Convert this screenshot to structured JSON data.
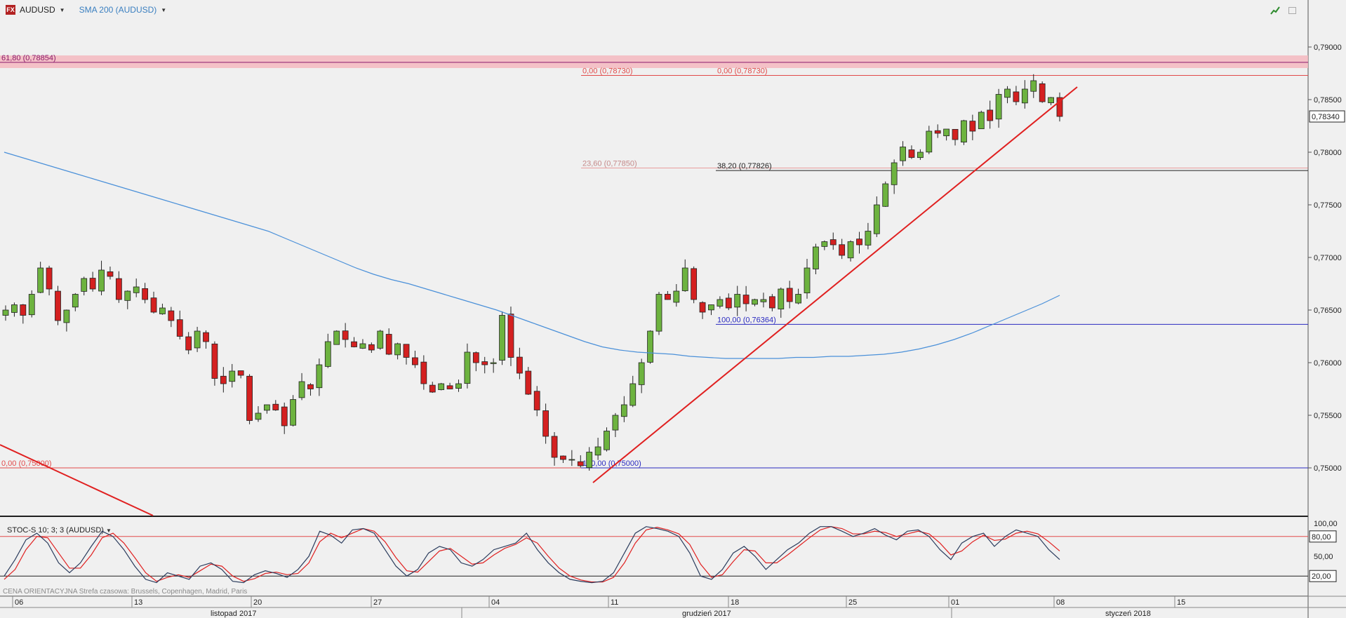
{
  "header": {
    "symbol": "AUDUSD",
    "indicator": "SMA 200 (AUDUSD)"
  },
  "stoch_header": "STOC-S 10; 3; 3 (AUDUSD)",
  "footer_note": "CENA ORIENTACYJNA   Strefa czasowa: Brussels, Copenhagen, Madrid, Paris",
  "colors": {
    "bull": "#6db33f",
    "bear": "#d42020",
    "sma": "#4a90d9",
    "trend": "#e02020",
    "fib_red": "#e24a4a",
    "fib_blue": "#2a2ac0",
    "zone": "#f4b8c0"
  },
  "chart_data": {
    "type": "candlestick",
    "price_axis": {
      "ticks": [
        "0,79000",
        "0,78500",
        "0,78000",
        "0,77500",
        "0,77000",
        "0,76500",
        "0,76000",
        "0,75500",
        "0,75000"
      ],
      "tick_values": [
        0.79,
        0.785,
        0.78,
        0.775,
        0.77,
        0.765,
        0.76,
        0.755,
        0.75
      ],
      "current_price": "0,78340",
      "current_value": 0.7834
    },
    "fib_levels": [
      {
        "label": "61,80 (0,78854)",
        "value": 0.78854,
        "color": "purple"
      },
      {
        "label": "0,00 (0,78730)",
        "value": 0.7873,
        "color": "red"
      },
      {
        "label": "0,00 (0,78730)",
        "value": 0.7873,
        "color": "red"
      },
      {
        "label": "23,60 (0,77850)",
        "value": 0.7785,
        "color": "red"
      },
      {
        "label": "38,20 (0,77826)",
        "value": 0.77826,
        "color": "black"
      },
      {
        "label": "100,00 (0,76364)",
        "value": 0.76364,
        "color": "blue"
      },
      {
        "label": "0,00 (0,75000)",
        "value": 0.75,
        "color": "red"
      },
      {
        "label": "100,00 (0,75000)",
        "value": 0.75,
        "color": "blue"
      }
    ],
    "resistance_zone": [
      0.788,
      0.7892
    ],
    "date_axis": {
      "days": [
        "06",
        "13",
        "20",
        "27",
        "04",
        "11",
        "18",
        "25",
        "01",
        "08",
        "15"
      ],
      "months": [
        "listopad 2017",
        "grudzień 2017",
        "styczeń 2018"
      ]
    },
    "ohlc_path": [
      0.765,
      0.7655,
      0.7645,
      0.7665,
      0.769,
      0.767,
      0.764,
      0.765,
      0.7665,
      0.768,
      0.767,
      0.7688,
      0.7682,
      0.766,
      0.7668,
      0.7672,
      0.766,
      0.7648,
      0.7652,
      0.764,
      0.7625,
      0.7612,
      0.763,
      0.762,
      0.7585,
      0.758,
      0.7592,
      0.7588,
      0.7545,
      0.7552,
      0.756,
      0.7555,
      0.754,
      0.7565,
      0.7582,
      0.7575,
      0.7598,
      0.762,
      0.763,
      0.7622,
      0.7615,
      0.7618,
      0.7612,
      0.763,
      0.7608,
      0.7618,
      0.7605,
      0.7598,
      0.758,
      0.7572,
      0.758,
      0.7575,
      0.758,
      0.761,
      0.76,
      0.7598,
      0.76,
      0.7645,
      0.7605,
      0.759,
      0.757,
      0.7555,
      0.753,
      0.751,
      0.7508,
      0.7508,
      0.7502,
      0.7515,
      0.752,
      0.7535,
      0.755,
      0.756,
      0.758,
      0.76,
      0.763,
      0.7665,
      0.766,
      0.7668,
      0.769,
      0.766,
      0.7648,
      0.7655,
      0.766,
      0.7652,
      0.7665,
      0.7656,
      0.766,
      0.766,
      0.7652,
      0.767,
      0.7658,
      0.7665,
      0.769,
      0.771,
      0.7715,
      0.7712,
      0.7702,
      0.7715,
      0.7712,
      0.7725,
      0.775,
      0.777,
      0.779,
      0.7805,
      0.7795,
      0.78,
      0.782,
      0.7818,
      0.7822,
      0.7812,
      0.783,
      0.782,
      0.7838,
      0.783,
      0.7855,
      0.786,
      0.7848,
      0.786,
      0.7868,
      0.7848,
      0.7852,
      0.7834
    ],
    "sma_200": [
      0.78,
      0.7795,
      0.779,
      0.7785,
      0.778,
      0.7775,
      0.777,
      0.7765,
      0.776,
      0.7755,
      0.775,
      0.7745,
      0.774,
      0.7735,
      0.773,
      0.7725,
      0.7718,
      0.7711,
      0.7704,
      0.7697,
      0.769,
      0.7684,
      0.7679,
      0.7675,
      0.767,
      0.7665,
      0.766,
      0.7655,
      0.765,
      0.7644,
      0.7638,
      0.7632,
      0.7626,
      0.762,
      0.7615,
      0.7612,
      0.761,
      0.7609,
      0.7608,
      0.7606,
      0.7605,
      0.7604,
      0.7604,
      0.7604,
      0.7604,
      0.7605,
      0.7605,
      0.7606,
      0.7606,
      0.7607,
      0.7608,
      0.761,
      0.7613,
      0.7617,
      0.7622,
      0.7628,
      0.7635,
      0.7642,
      0.7649,
      0.7656,
      0.7664
    ],
    "stochastic": {
      "axis_ticks": [
        "100,00",
        "50,00"
      ],
      "levels": [
        {
          "label": "80,00",
          "value": 80
        },
        {
          "label": "20,00",
          "value": 20
        }
      ],
      "k": [
        20,
        45,
        75,
        85,
        70,
        40,
        25,
        40,
        65,
        88,
        80,
        60,
        35,
        15,
        10,
        25,
        20,
        15,
        35,
        40,
        30,
        12,
        10,
        22,
        28,
        24,
        18,
        30,
        50,
        88,
        82,
        70,
        90,
        92,
        85,
        60,
        35,
        20,
        30,
        55,
        65,
        60,
        40,
        35,
        45,
        60,
        65,
        70,
        85,
        60,
        40,
        25,
        15,
        12,
        10,
        12,
        25,
        55,
        85,
        95,
        92,
        88,
        80,
        55,
        20,
        15,
        30,
        55,
        65,
        50,
        30,
        45,
        60,
        70,
        85,
        95,
        95,
        88,
        80,
        85,
        92,
        82,
        75,
        88,
        90,
        80,
        60,
        45,
        70,
        80,
        85,
        65,
        80,
        90,
        85,
        80,
        60,
        45
      ],
      "d": [
        15,
        30,
        60,
        80,
        78,
        55,
        32,
        32,
        52,
        78,
        85,
        70,
        48,
        25,
        12,
        18,
        22,
        18,
        28,
        38,
        35,
        20,
        12,
        16,
        24,
        26,
        22,
        24,
        40,
        72,
        85,
        78,
        85,
        92,
        88,
        72,
        48,
        28,
        26,
        42,
        58,
        62,
        50,
        38,
        40,
        52,
        62,
        68,
        78,
        70,
        50,
        32,
        20,
        14,
        11,
        11,
        18,
        40,
        70,
        90,
        94,
        90,
        84,
        68,
        38,
        18,
        22,
        42,
        60,
        58,
        40,
        40,
        52,
        65,
        78,
        90,
        95,
        92,
        84,
        84,
        88,
        86,
        80,
        84,
        88,
        84,
        70,
        52,
        58,
        72,
        82,
        74,
        76,
        85,
        88,
        84,
        72,
        58
      ]
    }
  }
}
